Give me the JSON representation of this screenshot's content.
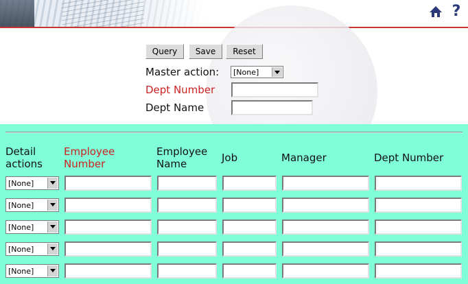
{
  "master": {
    "buttons": {
      "query": "Query",
      "save": "Save",
      "reset": "Reset"
    },
    "action_label": "Master action:",
    "action_value": "[None]",
    "dept_number_label": "Dept Number",
    "dept_number_value": "",
    "dept_name_label": "Dept Name",
    "dept_name_value": ""
  },
  "detail": {
    "columns": {
      "actions": "Detail actions",
      "emp_number": "Employee Number",
      "emp_name": "Employee Name",
      "job": "Job",
      "manager": "Manager",
      "dept_number": "Dept Number"
    },
    "rows": [
      {
        "action": "[None]",
        "emp_number": "",
        "emp_name": "",
        "job": "",
        "manager": "",
        "dept_number": ""
      },
      {
        "action": "[None]",
        "emp_number": "",
        "emp_name": "",
        "job": "",
        "manager": "",
        "dept_number": ""
      },
      {
        "action": "[None]",
        "emp_number": "",
        "emp_name": "",
        "job": "",
        "manager": "",
        "dept_number": ""
      },
      {
        "action": "[None]",
        "emp_number": "",
        "emp_name": "",
        "job": "",
        "manager": "",
        "dept_number": ""
      },
      {
        "action": "[None]",
        "emp_number": "",
        "emp_name": "",
        "job": "",
        "manager": "",
        "dept_number": ""
      }
    ]
  },
  "colors": {
    "accent_red": "#cc2222",
    "detail_bg": "#7ffed7",
    "icon_navy": "#2c3a7a"
  }
}
